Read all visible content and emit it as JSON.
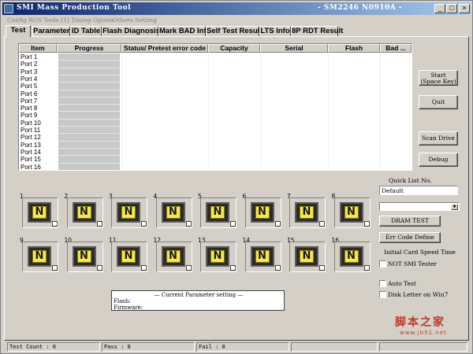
{
  "window": {
    "title": "SMI Mass Production Tool",
    "subtitle": "- SM2246 N0910A -",
    "minimize": "_",
    "maximize": "□",
    "close": "×"
  },
  "menu": [
    "Config ROS",
    "Tools [1]",
    "Dialog Option",
    "Others Setting"
  ],
  "tabs": [
    "Test",
    "Parameter",
    "ID Table",
    "Flash Diagnosis",
    "Mark BAD Info",
    "Self Test Result",
    "LTS Info",
    "8P RDT Result"
  ],
  "table": {
    "headers": [
      "Item",
      "Progress",
      "Status/ Pretest error code",
      "Capacity",
      "Serial",
      "Flash",
      "Bad ..."
    ],
    "rows": [
      "Port 1",
      "Port 2",
      "Port 3",
      "Port 4",
      "Port 5",
      "Port 6",
      "Port 7",
      "Port 8",
      "Port 9",
      "Port 10",
      "Port 11",
      "Port 12",
      "Port 13",
      "Port 14",
      "Port 15",
      "Port 16"
    ]
  },
  "buttons": {
    "start": [
      "Start",
      "(Space Key)"
    ],
    "quit": "Quit",
    "scan": "Scan Drive",
    "debug": "Debug",
    "dram_test": "DRAM TEST",
    "err_code": "Err Code Define"
  },
  "ports": [
    {
      "num": "1",
      "state": "N"
    },
    {
      "num": "2",
      "state": "N"
    },
    {
      "num": "3",
      "state": "N"
    },
    {
      "num": "4",
      "state": "N"
    },
    {
      "num": "5",
      "state": "N"
    },
    {
      "num": "6",
      "state": "N"
    },
    {
      "num": "7",
      "state": "N"
    },
    {
      "num": "8",
      "state": "N"
    },
    {
      "num": "9",
      "state": "N"
    },
    {
      "num": "10",
      "state": "N"
    },
    {
      "num": "11",
      "state": "N"
    },
    {
      "num": "12",
      "state": "N"
    },
    {
      "num": "13",
      "state": "N"
    },
    {
      "num": "14",
      "state": "N"
    },
    {
      "num": "15",
      "state": "N"
    },
    {
      "num": "16",
      "state": "N"
    }
  ],
  "side": {
    "quick_list_label": "Quick List No.",
    "quick_list_value": "Default",
    "dropdown_value": "",
    "initial_card_label": "Initial Card Speed Time",
    "not_smi_tester": "NOT SMI Tester",
    "auto_test": "Auto Test",
    "disk_letter": "Disk Letter on Win7"
  },
  "params": {
    "title": "— Current Parameter setting —",
    "flash": "Flash:",
    "firmware": "Firmware:"
  },
  "status": {
    "test_count": "Test Count : 0",
    "pass": "Pass : 0",
    "fail": "Fail : 0"
  },
  "watermark": {
    "text": "脚本之家",
    "url": "www.jb51.net"
  },
  "colors": {
    "title_start": "#0a246a",
    "title_end": "#a6caf0",
    "port_screen": "#f6e84a",
    "watermark": "#c0392b"
  }
}
